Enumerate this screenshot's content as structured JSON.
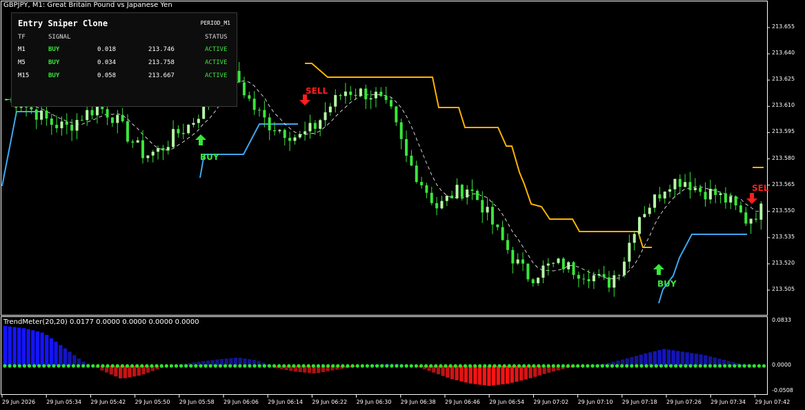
{
  "window": {
    "symbol_title": "GBPJPY, M1:  Great Britain Pound vs Japanese Yen",
    "indicator_title": "TrendMeter(20,20) 0.0177 0.0000 0.0000 0.0000 0.0000"
  },
  "panel": {
    "title": "Entry Sniper Clone",
    "period": "PERIOD_M1",
    "headers": {
      "tf": "TF",
      "signal": "SIGNAL",
      "status": "STATUS"
    },
    "rows": [
      {
        "tf": "M1",
        "signal": "BUY",
        "value": "0.018",
        "price": "213.746",
        "status": "ACTIVE"
      },
      {
        "tf": "M5",
        "signal": "BUY",
        "value": "0.034",
        "price": "213.758",
        "status": "ACTIVE"
      },
      {
        "tf": "M15",
        "signal": "BUY",
        "value": "0.058",
        "price": "213.667",
        "status": "ACTIVE"
      }
    ]
  },
  "signals": [
    {
      "label": "BUY",
      "type": "buy",
      "icon": "up-arrow-icon"
    },
    {
      "label": "SELL",
      "type": "sell",
      "icon": "down-arrow-icon"
    },
    {
      "label": "BUY",
      "type": "buy",
      "icon": "up-arrow-icon"
    },
    {
      "label": "SEL",
      "type": "sell",
      "icon": "down-arrow-icon"
    }
  ],
  "colors": {
    "bull": "#b7f7a8",
    "bear": "#39e63a",
    "wick": "#39e63a",
    "up_band": "#3fa8f4",
    "down_band": "#ffb400",
    "buy": "#39e63a",
    "sell": "#ff1e1e",
    "hist_pos": "#1414ff",
    "hist_neg": "#ff1e1e",
    "dots": "#29e62a"
  },
  "chart_data": {
    "type": "candlestick",
    "y_axis_labels": [
      "213.655",
      "213.640",
      "213.625",
      "213.610",
      "213.595",
      "213.580",
      "213.565",
      "213.550",
      "213.535",
      "213.520",
      "213.505"
    ],
    "x_axis_labels": [
      "29 Jun 2026",
      "29 Jun 05:34",
      "29 Jun 05:42",
      "29 Jun 05:50",
      "29 Jun 05:58",
      "29 Jun 06:06",
      "29 Jun 06:14",
      "29 Jun 06:22",
      "29 Jun 06:30",
      "29 Jun 06:38",
      "29 Jun 06:46",
      "29 Jun 06:54",
      "29 Jun 07:02",
      "29 Jun 07:10",
      "29 Jun 07:18",
      "29 Jun 07:26",
      "29 Jun 07:34",
      "29 Jun 07:42"
    ],
    "ylim": [
      213.4985,
      213.6545
    ],
    "close_keypoints": [
      213.614,
      213.612,
      213.606,
      213.6,
      213.598,
      213.605,
      213.61,
      213.604,
      213.592,
      213.582,
      213.585,
      213.594,
      213.6,
      213.612,
      213.63,
      213.626,
      213.61,
      213.6,
      213.596,
      213.592,
      213.598,
      213.61,
      213.619,
      213.618,
      213.616,
      213.606,
      213.58,
      213.566,
      213.552,
      213.56,
      213.564,
      213.552,
      213.536,
      213.522,
      213.512,
      213.518,
      213.52,
      213.516,
      213.514,
      213.508,
      213.52,
      213.547,
      213.556,
      213.567,
      213.568,
      213.562,
      213.56,
      213.555,
      213.545,
      213.551
    ],
    "indicator": {
      "name": "TrendMeter(20,20)",
      "y_axis_labels": [
        "0.0833",
        "0.0000",
        "-0.0508"
      ],
      "ylim": [
        -0.0508,
        0.0833
      ],
      "hist_keypoints": [
        0.085,
        0.08,
        0.07,
        0.04,
        0.01,
        -0.008,
        -0.022,
        -0.016,
        -0.004,
        0.003,
        0.009,
        0.014,
        0.018,
        0.012,
        -0.004,
        -0.01,
        -0.013,
        -0.007,
        -0.002,
        0.003,
        0.005,
        0.002,
        -0.01,
        -0.022,
        -0.03,
        -0.034,
        -0.03,
        -0.022,
        -0.012,
        -0.004,
        0.0,
        0.005,
        0.015,
        0.026,
        0.036,
        0.03,
        0.024,
        0.014,
        0.004,
        0.0
      ]
    }
  }
}
